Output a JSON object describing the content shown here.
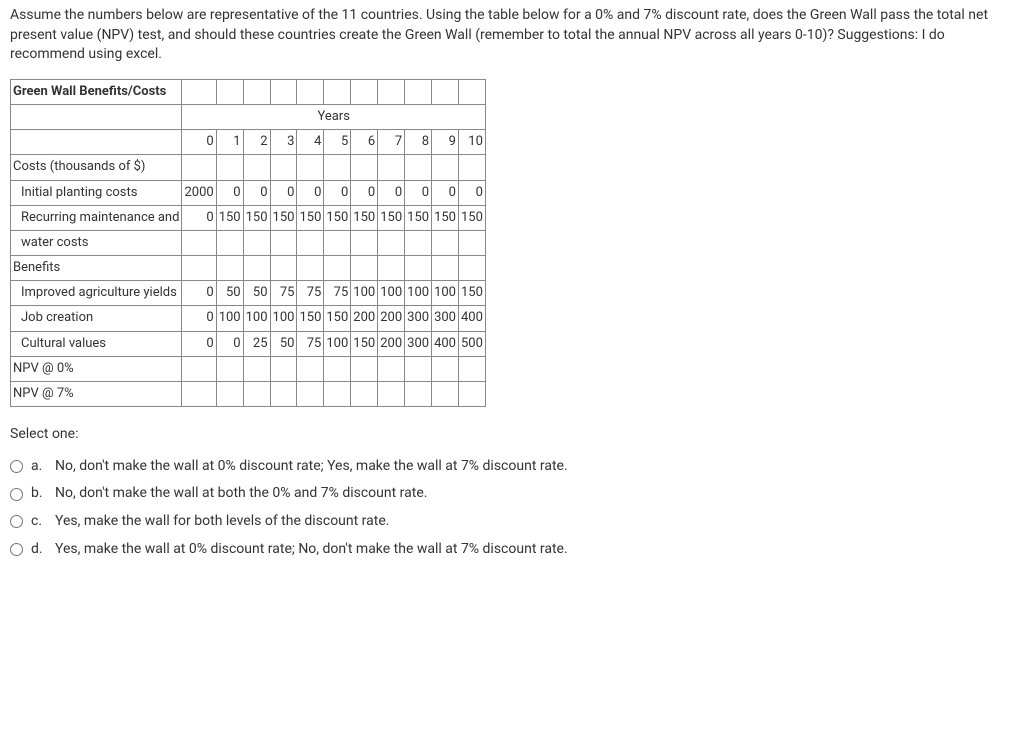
{
  "question": "Assume the numbers below are representative of the 11 countries. Using the table below for a 0% and 7% discount rate, does the Green Wall pass the total net present value (NPV) test, and should these countries create the Green Wall (remember to total the annual NPV across all years 0-10)? Suggestions: I do recommend using excel.",
  "table": {
    "title": "Green Wall Benefits/Costs",
    "years_label": "Years",
    "year_headers": [
      "0",
      "1",
      "2",
      "3",
      "4",
      "5",
      "6",
      "7",
      "8",
      "9",
      "10"
    ],
    "rows": [
      {
        "label": "Costs (thousands of $)",
        "sub": false,
        "values": [
          "",
          "",
          "",
          "",
          "",
          "",
          "",
          "",
          "",
          "",
          ""
        ]
      },
      {
        "label": "Initial planting costs",
        "sub": true,
        "values": [
          "2000",
          "0",
          "0",
          "0",
          "0",
          "0",
          "0",
          "0",
          "0",
          "0",
          "0"
        ]
      },
      {
        "label": "Recurring maintenance and",
        "sub": true,
        "values": [
          "0",
          "150",
          "150",
          "150",
          "150",
          "150",
          "150",
          "150",
          "150",
          "150",
          "150"
        ]
      },
      {
        "label": "water costs",
        "sub": true,
        "values": [
          "",
          "",
          "",
          "",
          "",
          "",
          "",
          "",
          "",
          "",
          ""
        ]
      },
      {
        "label": "Benefits",
        "sub": false,
        "values": [
          "",
          "",
          "",
          "",
          "",
          "",
          "",
          "",
          "",
          "",
          ""
        ]
      },
      {
        "label": "Improved agriculture yields",
        "sub": true,
        "values": [
          "0",
          "50",
          "50",
          "75",
          "75",
          "75",
          "100",
          "100",
          "100",
          "100",
          "150"
        ]
      },
      {
        "label": "Job creation",
        "sub": true,
        "values": [
          "0",
          "100",
          "100",
          "100",
          "150",
          "150",
          "200",
          "200",
          "300",
          "300",
          "400"
        ]
      },
      {
        "label": "Cultural values",
        "sub": true,
        "values": [
          "0",
          "0",
          "25",
          "50",
          "75",
          "100",
          "150",
          "200",
          "300",
          "400",
          "500"
        ]
      },
      {
        "label": "NPV @ 0%",
        "sub": false,
        "values": [
          "",
          "",
          "",
          "",
          "",
          "",
          "",
          "",
          "",
          "",
          ""
        ]
      },
      {
        "label": "NPV @ 7%",
        "sub": false,
        "values": [
          "",
          "",
          "",
          "",
          "",
          "",
          "",
          "",
          "",
          "",
          ""
        ]
      }
    ]
  },
  "select_one": "Select one:",
  "options": [
    {
      "letter": "a.",
      "text": "No, don't make the wall at 0% discount rate; Yes, make the wall at 7% discount rate."
    },
    {
      "letter": "b.",
      "text": "No, don't make the wall at both the 0% and 7% discount rate."
    },
    {
      "letter": "c.",
      "text": "Yes, make the wall for both levels of the discount rate."
    },
    {
      "letter": "d.",
      "text": "Yes, make the wall at 0% discount rate;  No, don't make the wall at 7% discount rate."
    }
  ],
  "chart_data": {
    "type": "table",
    "title": "Green Wall Benefits/Costs",
    "years": [
      0,
      1,
      2,
      3,
      4,
      5,
      6,
      7,
      8,
      9,
      10
    ],
    "costs_thousands_usd": {
      "initial_planting_costs": [
        2000,
        0,
        0,
        0,
        0,
        0,
        0,
        0,
        0,
        0,
        0
      ],
      "recurring_maintenance_and_water_costs": [
        0,
        150,
        150,
        150,
        150,
        150,
        150,
        150,
        150,
        150,
        150
      ]
    },
    "benefits_thousands_usd": {
      "improved_agriculture_yields": [
        0,
        50,
        50,
        75,
        75,
        75,
        100,
        100,
        100,
        100,
        150
      ],
      "job_creation": [
        0,
        100,
        100,
        100,
        150,
        150,
        200,
        200,
        300,
        300,
        400
      ],
      "cultural_values": [
        0,
        0,
        25,
        50,
        75,
        100,
        150,
        200,
        300,
        400,
        500
      ]
    },
    "npv_rows": [
      "NPV @ 0%",
      "NPV @ 7%"
    ]
  }
}
